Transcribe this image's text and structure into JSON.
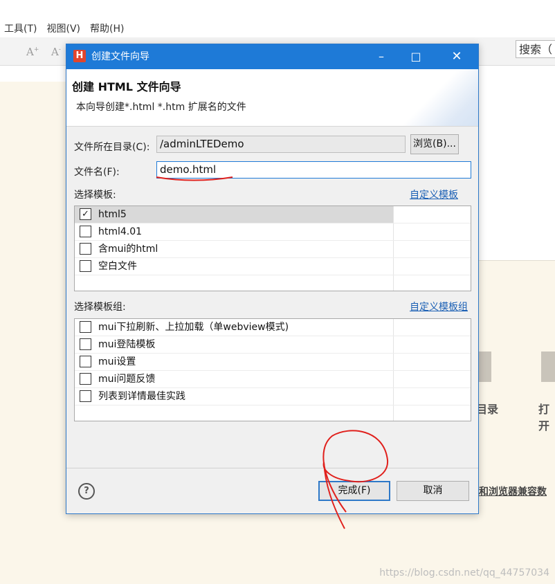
{
  "ide": {
    "menu": [
      "工具(T)",
      "视图(V)",
      "帮助(H)"
    ],
    "search_label": "搜索（",
    "labels": [
      "目录",
      "打开"
    ],
    "link_text": "和浏览器兼容数",
    "watermark": "https://blog.csdn.net/qq_44757034"
  },
  "dialog": {
    "title": "创建文件向导",
    "heading": "创建 HTML 文件向导",
    "description": "本向导创建*.html *.htm 扩展名的文件",
    "dir_label": "文件所在目录(C):",
    "dir_value": "/adminLTEDemo",
    "browse_label": "浏览(B)...",
    "name_label": "文件名(F):",
    "name_value": "demo.html",
    "template_label": "选择模板:",
    "template_link": "自定义模板",
    "templates": [
      {
        "label": "html5",
        "checked": true
      },
      {
        "label": "html4.01",
        "checked": false
      },
      {
        "label": "含mui的html",
        "checked": false
      },
      {
        "label": "空白文件",
        "checked": false
      }
    ],
    "group_label": "选择模板组:",
    "group_link": "自定义模板组",
    "groups": [
      {
        "label": "mui下拉刷新、上拉加载（单webview模式)",
        "checked": false
      },
      {
        "label": "mui登陆模板",
        "checked": false
      },
      {
        "label": "mui设置",
        "checked": false
      },
      {
        "label": "mui问题反馈",
        "checked": false
      },
      {
        "label": "列表到详情最佳实践",
        "checked": false
      }
    ],
    "finish_label": "完成(F)",
    "cancel_label": "取消"
  },
  "colors": {
    "titlebar": "#1e7ad7",
    "annotation": "#e0201c",
    "link": "#1a5fb4"
  }
}
